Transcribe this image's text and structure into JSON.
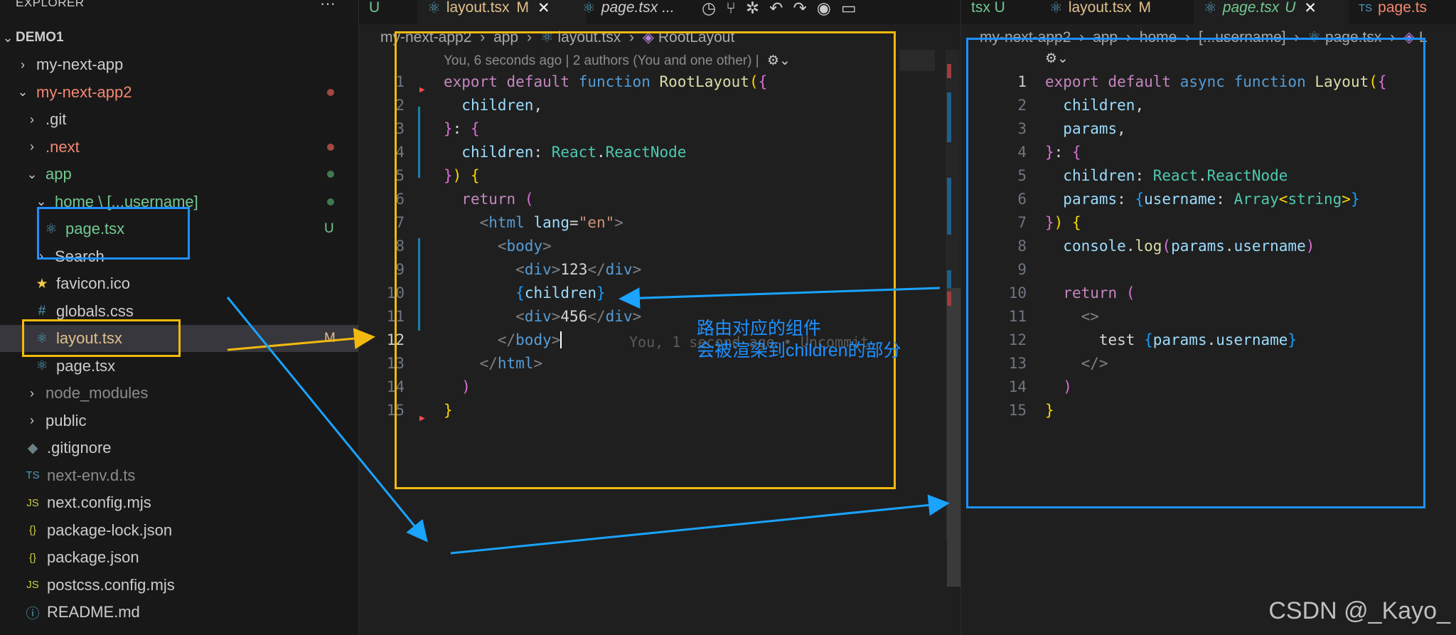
{
  "explorer": {
    "title": "EXPLORER",
    "more": "···",
    "root": "DEMO1",
    "items": [
      {
        "label": "my-next-app",
        "type": "folder",
        "open": false,
        "color": "#cccccc",
        "indent": 1
      },
      {
        "label": "my-next-app2",
        "type": "folder",
        "open": true,
        "color": "#f48771",
        "indent": 1,
        "status": "dot-red"
      },
      {
        "label": ".git",
        "type": "folder",
        "open": false,
        "color": "#cccccc",
        "indent": 2
      },
      {
        "label": ".next",
        "type": "folder",
        "open": false,
        "color": "#f48771",
        "indent": 2,
        "status": "dot-red"
      },
      {
        "label": "app",
        "type": "folder",
        "open": true,
        "color": "#73c991",
        "indent": 2,
        "status": "dot-green"
      },
      {
        "label": "home \\ [...username]",
        "type": "folder",
        "open": true,
        "color": "#73c991",
        "indent": 3,
        "status": "dot-green"
      },
      {
        "label": "page.tsx",
        "type": "react",
        "color": "#73c991",
        "indent": 4,
        "status": "U"
      },
      {
        "label": "Search",
        "type": "folder",
        "open": false,
        "color": "#cccccc",
        "indent": 3
      },
      {
        "label": "favicon.ico",
        "type": "star",
        "color": "#cccccc",
        "indent": 3
      },
      {
        "label": "globals.css",
        "type": "css",
        "color": "#cccccc",
        "indent": 3
      },
      {
        "label": "layout.tsx",
        "type": "react",
        "color": "#e2c08d",
        "indent": 3,
        "status": "M",
        "selected": true
      },
      {
        "label": "page.tsx",
        "type": "react",
        "color": "#cccccc",
        "indent": 3
      },
      {
        "label": "node_modules",
        "type": "folder",
        "open": false,
        "color": "#8c8c8c",
        "indent": 2
      },
      {
        "label": "public",
        "type": "folder",
        "open": false,
        "color": "#cccccc",
        "indent": 2
      },
      {
        "label": ".gitignore",
        "type": "git",
        "color": "#cccccc",
        "indent": 2
      },
      {
        "label": "next-env.d.ts",
        "type": "ts",
        "color": "#8c8c8c",
        "indent": 2
      },
      {
        "label": "next.config.mjs",
        "type": "js",
        "color": "#cccccc",
        "indent": 2
      },
      {
        "label": "package-lock.json",
        "type": "json",
        "color": "#cccccc",
        "indent": 2
      },
      {
        "label": "package.json",
        "type": "json",
        "color": "#cccccc",
        "indent": 2
      },
      {
        "label": "postcss.config.mjs",
        "type": "js",
        "color": "#cccccc",
        "indent": 2
      },
      {
        "label": "README.md",
        "type": "info",
        "color": "#cccccc",
        "indent": 2
      }
    ]
  },
  "editor1": {
    "tabs": [
      {
        "label": "U",
        "color": "#73c991"
      },
      {
        "label": "layout.tsx",
        "badge": "M",
        "color": "#e2c08d",
        "active": true,
        "close": "✕"
      },
      {
        "label": "page.tsx",
        "badge": "...",
        "color": "#cccccc",
        "italic": true
      }
    ],
    "breadcrumb": [
      "my-next-app2",
      "app",
      "layout.tsx",
      "RootLayout"
    ],
    "blame": "You, 6 seconds ago | 2 authors (You and one other) |",
    "inline_blame": "You, 1 second ago • Uncommit",
    "line_numbers": [
      "1",
      "2",
      "3",
      "4",
      "5",
      "6",
      "7",
      "8",
      "9",
      "10",
      "11",
      "12",
      "13",
      "14",
      "15"
    ]
  },
  "editor2": {
    "tabs": [
      {
        "label": "tsx U",
        "color": "#73c991"
      },
      {
        "label": "layout.tsx",
        "badge": "M",
        "color": "#e2c08d"
      },
      {
        "label": "page.tsx",
        "badge": "U",
        "color": "#73c991",
        "active": true,
        "italic": true,
        "close": "✕"
      },
      {
        "label": "page.ts",
        "badge": "TS",
        "color": "#f48771"
      }
    ],
    "breadcrumb": [
      "my-next-app2",
      "app",
      "home",
      "[...username]",
      "page.tsx",
      "L"
    ],
    "line_numbers": [
      "1",
      "2",
      "3",
      "4",
      "5",
      "6",
      "7",
      "8",
      "9",
      "10",
      "11",
      "12",
      "13",
      "14",
      "15"
    ]
  },
  "annotation": {
    "line1": "路由对应的组件",
    "line2": "会被渲染到children的部分"
  },
  "watermark": "CSDN @_Kayo_",
  "colors": {
    "yellow_box": "#f2b90f",
    "blue_box": "#1e90ff",
    "arrow": "#1aa3ff"
  }
}
